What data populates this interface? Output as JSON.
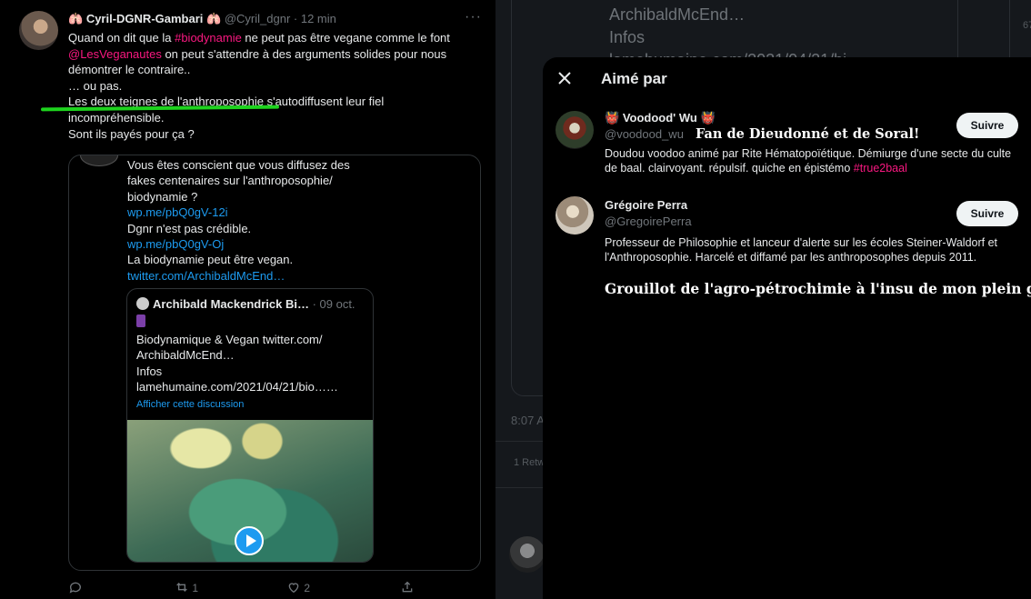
{
  "tweet": {
    "name": "Cyril-DGNR-Gambari",
    "name_emoji": "🫁",
    "handle": "@Cyril_dgnr",
    "time": "· 12 min",
    "more": "···",
    "line1_a": "Quand on dit que la ",
    "line1_tag": "#biodynamie",
    "line1_b": " ne peut pas être vegane comme le font ",
    "line1_mention": "@LesVeganautes",
    "line1_c": " on peut s'attendre à des arguments solides pour nous démontrer le contraire..",
    "line2": "… ou pas.",
    "line3": "Les deux teignes de l'anthroposophie s'autodiffusent leur fiel incompréhensible.",
    "line4": "Sont ils payés pour ça ?"
  },
  "quote": {
    "text1": "Vous êtes conscient que vous diffusez des fakes centenaires sur l'anthroposophie/ biodynamie ?",
    "link1": "wp.me/pbQ0gV-12i",
    "text2": "Dgnr n'est pas crédible.",
    "link2": "wp.me/pbQ0gV-Oj",
    "text3": "La biodynamie peut être vegan.",
    "link3": "twitter.com/ArchibaldMcEnd…"
  },
  "inner_quote": {
    "name": "Archibald Mackendrick Bi…",
    "date": "· 09 oct.",
    "line1": "Biodynamique & Vegan twitter.com/ ArchibaldMcEnd…",
    "line2": "Infos",
    "line3": "lamehumaine.com/2021/04/21/bio……",
    "show_thread": "Afficher cette discussion"
  },
  "actions": {
    "retweets": "1",
    "likes": "2"
  },
  "background": {
    "text1": "ArchibaldMcEnd…",
    "text2": "Infos",
    "text3": "lamehumaine.com/2021/04/21/bi…",
    "time": "8:07 A",
    "retweets": "1 Retw",
    "edge_num": "67",
    "edge_c": "©"
  },
  "modal": {
    "title": "Aimé par",
    "users": [
      {
        "name": "Voodood' Wu",
        "emoji": "👹",
        "handle": "@voodood_wu",
        "overlay": "Fan de Dieudonné et de Soral!",
        "follow": "Suivre",
        "bio_a": "Doudou voodoo animé par Rite Hématopoïétique. Démiurge d'une secte du culte de baal. clairvoyant. répulsif. quiche en épistémo ",
        "bio_tag": "#true2baal"
      },
      {
        "name": "Grégoire Perra",
        "handle": "@GregoirePerra",
        "follow": "Suivre",
        "bio": "Professeur de Philosophie et lanceur d'alerte sur les écoles Steiner-Waldorf et l'Anthroposophie. Harcelé et diffamé par les anthroposophes depuis 2011.",
        "overlay": "Grouillot de l'agro-pétrochimie à l'insu de mon plein gré"
      }
    ]
  },
  "colors": {
    "accent": "#1d9bf0",
    "hashtag": "#f91880",
    "highlight": "#1ed31e"
  }
}
